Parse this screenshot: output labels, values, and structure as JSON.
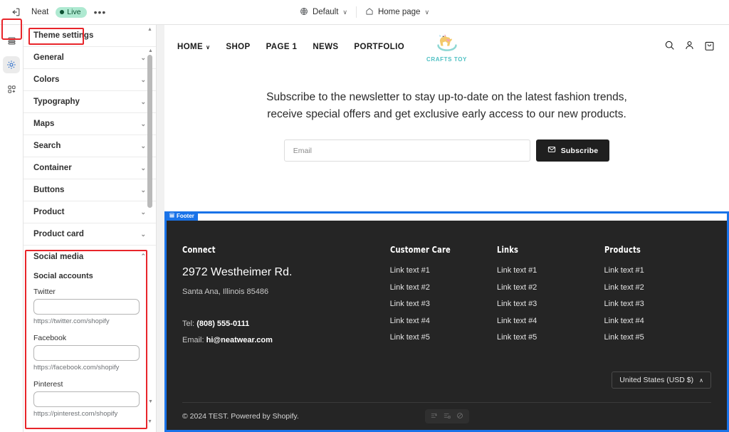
{
  "topbar": {
    "exit_icon": "exit-icon",
    "store_name": "Neat",
    "status_label": "Live",
    "more_label": "•••",
    "theme_chip": {
      "icon": "globe-icon",
      "label": "Default",
      "caret": "∨"
    },
    "page_chip": {
      "icon": "home-icon",
      "label": "Home page",
      "caret": "∨"
    }
  },
  "rail": {
    "items": [
      {
        "name": "sections-icon",
        "label": "Sections"
      },
      {
        "name": "gear-icon",
        "label": "Theme settings"
      },
      {
        "name": "apps-icon",
        "label": "Apps"
      }
    ]
  },
  "sidebar": {
    "header": "Theme settings",
    "items": [
      {
        "label": "General"
      },
      {
        "label": "Colors"
      },
      {
        "label": "Typography"
      },
      {
        "label": "Maps"
      },
      {
        "label": "Search"
      },
      {
        "label": "Container"
      },
      {
        "label": "Buttons"
      },
      {
        "label": "Product"
      },
      {
        "label": "Product card"
      }
    ],
    "social": {
      "title": "Social media",
      "caret": "∧",
      "subtitle": "Social accounts",
      "fields": [
        {
          "label": "Twitter",
          "value": "",
          "help": "https://twitter.com/shopify"
        },
        {
          "label": "Facebook",
          "value": "",
          "help": "https://facebook.com/shopify"
        },
        {
          "label": "Pinterest",
          "value": "",
          "help": "https://pinterest.com/shopify"
        }
      ]
    }
  },
  "store": {
    "nav": [
      {
        "label": "HOME",
        "caret": "∨"
      },
      {
        "label": "SHOP",
        "caret": ""
      },
      {
        "label": "PAGE 1",
        "caret": ""
      },
      {
        "label": "NEWS",
        "caret": ""
      },
      {
        "label": "PORTFOLIO",
        "caret": ""
      }
    ],
    "logo_text": "CRAFTS TOY",
    "header_icons": [
      "search-icon",
      "account-icon",
      "cart-icon"
    ],
    "newsletter": {
      "text": "Subscribe to the newsletter to stay up-to-date on the latest fashion trends, receive special offers and get exclusive early access to our new products.",
      "email_placeholder": "Email",
      "email_value": "",
      "button_label": "Subscribe"
    }
  },
  "footer": {
    "section_tag": "Footer",
    "connect": {
      "heading": "Connect",
      "address": "2972 Westheimer Rd.",
      "city": "Santa Ana, Illinois 85486",
      "tel_label": "Tel:",
      "tel_value": "(808) 555-0111",
      "email_label": "Email:",
      "email_value": "hi@neatwear.com"
    },
    "columns": [
      {
        "heading": "Customer Care",
        "links": [
          "Link text #1",
          "Link text #2",
          "Link text #3",
          "Link text #4",
          "Link text #5"
        ]
      },
      {
        "heading": "Links",
        "links": [
          "Link text #1",
          "Link text #2",
          "Link text #3",
          "Link text #4",
          "Link text #5"
        ]
      },
      {
        "heading": "Products",
        "links": [
          "Link text #1",
          "Link text #2",
          "Link text #3",
          "Link text #4",
          "Link text #5"
        ]
      }
    ],
    "country_selector": {
      "label": "United States (USD $)",
      "caret": "∧"
    },
    "copyright": "© 2024 TEST. Powered by Shopify.",
    "payment_icons": [
      "payment-icon-1",
      "payment-icon-2",
      "payment-icon-3"
    ]
  },
  "colors": {
    "accent_blue": "#1a73e8",
    "highlight_red": "#e8252a",
    "footer_bg": "#252525",
    "live_badge_bg": "#aee9d1",
    "logo_teal": "#4ec0c3"
  }
}
